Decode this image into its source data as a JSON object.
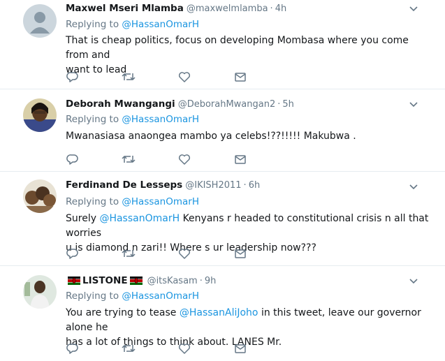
{
  "tweets": [
    {
      "name": "Maxwel Mseri Mlamba",
      "handle": "@maxwelmlamba",
      "time": "4h",
      "replying_label": "Replying to",
      "replying_to": "@HassanOmarH",
      "text_line1": "That is cheap politics, focus on developing Mombasa where you come from and",
      "text_line2": "want to lead",
      "avatar": "default-egg-avatar"
    },
    {
      "name": "Deborah Mwangangi",
      "handle": "@DeborahMwangan2",
      "time": "5h",
      "replying_label": "Replying to",
      "replying_to": "@HassanOmarH",
      "text_line1": "Mwanasiasa anaongea mambo ya celebs!??!!!!! Makubwa .",
      "avatar": "photo-avatar"
    },
    {
      "name": "Ferdinand De Lesseps",
      "handle": "@IKISH2011",
      "time": "6h",
      "replying_label": "Replying to",
      "replying_to": "@HassanOmarH",
      "text_prefix": "Surely ",
      "text_mention": "@HassanOmarH",
      "text_rest": " Kenyans r headed to constitutional crisis n all that worries",
      "text_line2": "u is diamond n zari!! Where s ur leadership now???",
      "avatar": "photo-avatar"
    },
    {
      "name": "LISTONE",
      "handle": "@itsKasam",
      "time": "9h",
      "replying_label": "Replying to",
      "replying_to": "@HassanOmarH",
      "text_prefix": "You are trying to tease ",
      "text_mention": "@HassanAliJoho",
      "text_rest": " in this tweet, leave our governor alone he",
      "text_line2": "has a lot of things to think about. LANES Mr.",
      "avatar": "photo-avatar",
      "name_decoration": "kenya-flag-icon"
    }
  ],
  "separator": "·",
  "icons": {
    "reply": "reply-icon",
    "retweet": "retweet-icon",
    "like": "like-icon",
    "dm": "direct-message-icon",
    "more": "chevron-down-icon"
  },
  "colors": {
    "text": "#14171a",
    "muted": "#657786",
    "link": "#1b95e0",
    "divider": "#e6ecf0"
  }
}
